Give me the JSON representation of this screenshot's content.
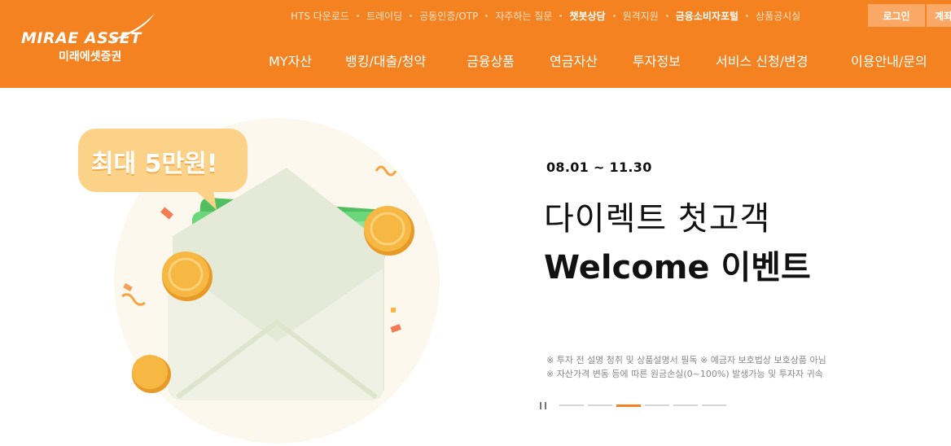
{
  "brand": {
    "logo_main": "MIRAE ASSET",
    "logo_sub": "미래에셋증권"
  },
  "util_links": [
    {
      "label": "HTS 다운로드",
      "strong": false
    },
    {
      "label": "트레이딩",
      "strong": false
    },
    {
      "label": "공동인증/OTP",
      "strong": false
    },
    {
      "label": "자주하는 질문",
      "strong": false
    },
    {
      "label": "챗봇상담",
      "strong": true
    },
    {
      "label": "원격지원",
      "strong": false
    },
    {
      "label": "금융소비자포털",
      "strong": true
    },
    {
      "label": "상품공시실",
      "strong": false
    }
  ],
  "header_buttons": {
    "login": "로그인",
    "account": "계좌개설"
  },
  "gnb": [
    "MY자산",
    "뱅킹/대출/청약",
    "금융상품",
    "연금자산",
    "투자정보",
    "서비스 신청/변경",
    "이용안내/문의"
  ],
  "hero": {
    "badge": "최대 5만원!",
    "currency_symbol": "₩",
    "period": "08.01 ~ 11.30",
    "title_line1": "다이렉트 첫고객",
    "title_line2": "Welcome 이벤트",
    "notes": [
      "※ 투자 전 설명 청취 및 상품설명서 필독 ※ 예금자 보호법상 보호상품 아님",
      "※ 자산가격 변동 등에 따른 원금손실(0~100%) 발생가능 및 투자자 귀속"
    ]
  },
  "slider": {
    "total": 6,
    "active_index": 2
  },
  "colors": {
    "brand_orange": "#f58220",
    "button_light_orange": "#f9a865",
    "badge_yellow": "#fcd289",
    "money_green": "#5ccd6a",
    "coin_gold": "#f6b843",
    "envelope": "#eef1e4"
  }
}
